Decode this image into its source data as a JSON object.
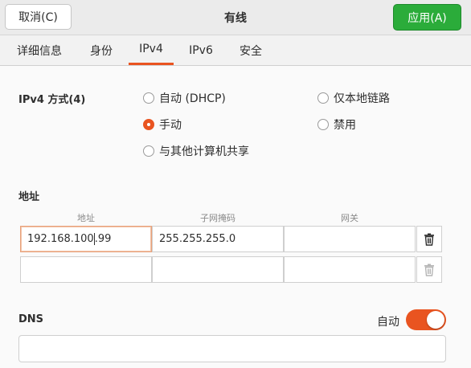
{
  "header": {
    "cancel_label": "取消(C)",
    "title": "有线",
    "apply_label": "应用(A)"
  },
  "tabs": [
    {
      "label": "详细信息",
      "active": false
    },
    {
      "label": "身份",
      "active": false
    },
    {
      "label": "IPv4",
      "active": true
    },
    {
      "label": "IPv6",
      "active": false
    },
    {
      "label": "安全",
      "active": false
    }
  ],
  "ipv4_method": {
    "label": "IPv4 方式(4)",
    "options": [
      {
        "label": "自动 (DHCP)",
        "checked": false
      },
      {
        "label": "仅本地链路",
        "checked": false
      },
      {
        "label": "手动",
        "checked": true
      },
      {
        "label": "禁用",
        "checked": false
      },
      {
        "label": "与其他计算机共享",
        "checked": false
      }
    ]
  },
  "addresses": {
    "label": "地址",
    "columns": [
      "地址",
      "子网掩码",
      "网关"
    ],
    "rows": [
      {
        "address_before_caret": "192.168.100",
        "address_after_caret": ".99",
        "netmask": "255.255.255.0",
        "gateway": ""
      },
      {
        "address": "",
        "netmask": "",
        "gateway": ""
      }
    ]
  },
  "dns": {
    "label": "DNS",
    "auto_label": "自动",
    "auto_enabled": true,
    "value": ""
  },
  "colors": {
    "accent": "#e95420",
    "apply_button": "#2bac3a"
  },
  "icons": {
    "delete": "trash-icon"
  }
}
